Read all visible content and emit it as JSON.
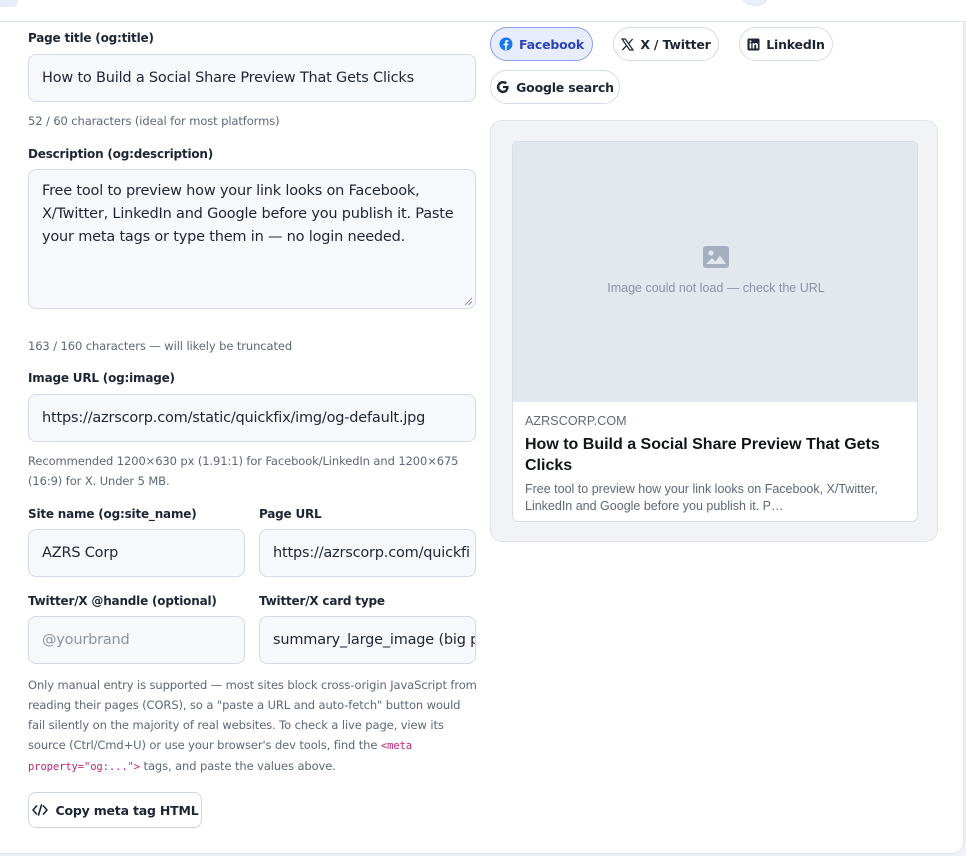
{
  "form": {
    "title": {
      "label": "Page title (og:title)",
      "value": "How to Build a Social Share Preview That Gets Clicks",
      "hint": "52 / 60 characters (ideal for most platforms)"
    },
    "description": {
      "label": "Description (og:description)",
      "value": "Free tool to preview how your link looks on Facebook, X/Twitter, LinkedIn and Google before you publish it. Paste your meta tags or type them in — no login needed.",
      "hint": "163 / 160 characters — will likely be truncated"
    },
    "image": {
      "label": "Image URL (og:image)",
      "value": "https://azrscorp.com/static/quickfix/img/og-default.jpg",
      "hint": "Recommended 1200×630 px (1.91:1) for Facebook/LinkedIn and 1200×675 (16:9) for X. Under 5 MB."
    },
    "site_name": {
      "label": "Site name (og:site_name)",
      "value": "AZRS Corp"
    },
    "page_url": {
      "label": "Page URL",
      "value": "https://azrscorp.com/quickfi"
    },
    "twitter_handle": {
      "label": "Twitter/X @handle (optional)",
      "placeholder": "@yourbrand",
      "value": ""
    },
    "twitter_card": {
      "label": "Twitter/X card type",
      "value": "summary_large_image (big p"
    },
    "note": {
      "part1": "Only manual entry is supported — most sites block cross-origin JavaScript from reading their pages (CORS), so a \"paste a URL and auto-fetch\" button would fail silently on the majority of real websites. To check a live page, view its source (Ctrl/Cmd+U) or use your browser's dev tools, find the ",
      "code": "<meta property=\"og:...\">",
      "part2": " tags, and paste the values above."
    },
    "copy_button": "Copy meta tag HTML"
  },
  "tabs": [
    {
      "label": "Facebook",
      "icon": "facebook-icon",
      "active": true
    },
    {
      "label": "X / Twitter",
      "icon": "x-icon",
      "active": false
    },
    {
      "label": "LinkedIn",
      "icon": "linkedin-icon",
      "active": false
    },
    {
      "label": "Google search",
      "icon": "google-icon",
      "active": false
    }
  ],
  "preview": {
    "image_error": "Image could not load — check the URL",
    "domain": "AZRSCORP.COM",
    "title": "How to Build a Social Share Preview That Gets Clicks",
    "description": "Free tool to preview how your link looks on Facebook, X/Twitter, LinkedIn and Google before you publish it. P…"
  },
  "colors": {
    "accent": "#2c44b8",
    "accent_bg": "#e8edfd",
    "facebook_blue": "#1877f2",
    "code_text": "#c0267a"
  }
}
